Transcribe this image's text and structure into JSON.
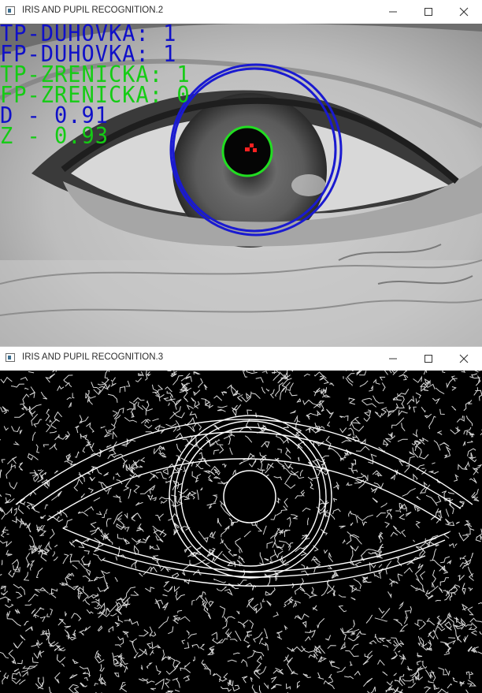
{
  "colors": {
    "iris_circle": "#1a1ad0",
    "pupil_circle": "#22dd22",
    "center_mark": "#ff0000",
    "tp_fp_iris_text": "#1010c8",
    "tp_fp_pupil_text": "#14cc14",
    "edges": "#ffffff",
    "edges_background": "#000000"
  },
  "windows": [
    {
      "title": "IRIS AND PUPIL RECOGNITION.2",
      "icon": "window-app-icon",
      "controls": [
        "minimize-icon",
        "maximize-icon",
        "close-icon"
      ],
      "image": "grayscale eye photo with detected iris and pupil circles",
      "overlay_lines": [
        {
          "text": "TP-DUHOVKA: 1",
          "color": "#1010c8"
        },
        {
          "text": "FP-DUHOVKA: 1",
          "color": "#1010c8"
        },
        {
          "text": "TP-ZRENICKA: 1",
          "color": "#14cc14"
        },
        {
          "text": "FP-ZRENICKA: 0",
          "color": "#14cc14"
        },
        {
          "text": "D - 0.91",
          "color": "#1010c8"
        },
        {
          "text": "Z - 0.93",
          "color": "#14cc14"
        }
      ]
    },
    {
      "title": "IRIS AND PUPIL RECOGNITION.3",
      "icon": "window-app-icon",
      "controls": [
        "minimize-icon",
        "maximize-icon",
        "close-icon"
      ],
      "image": "edge detection map of the eye"
    }
  ]
}
